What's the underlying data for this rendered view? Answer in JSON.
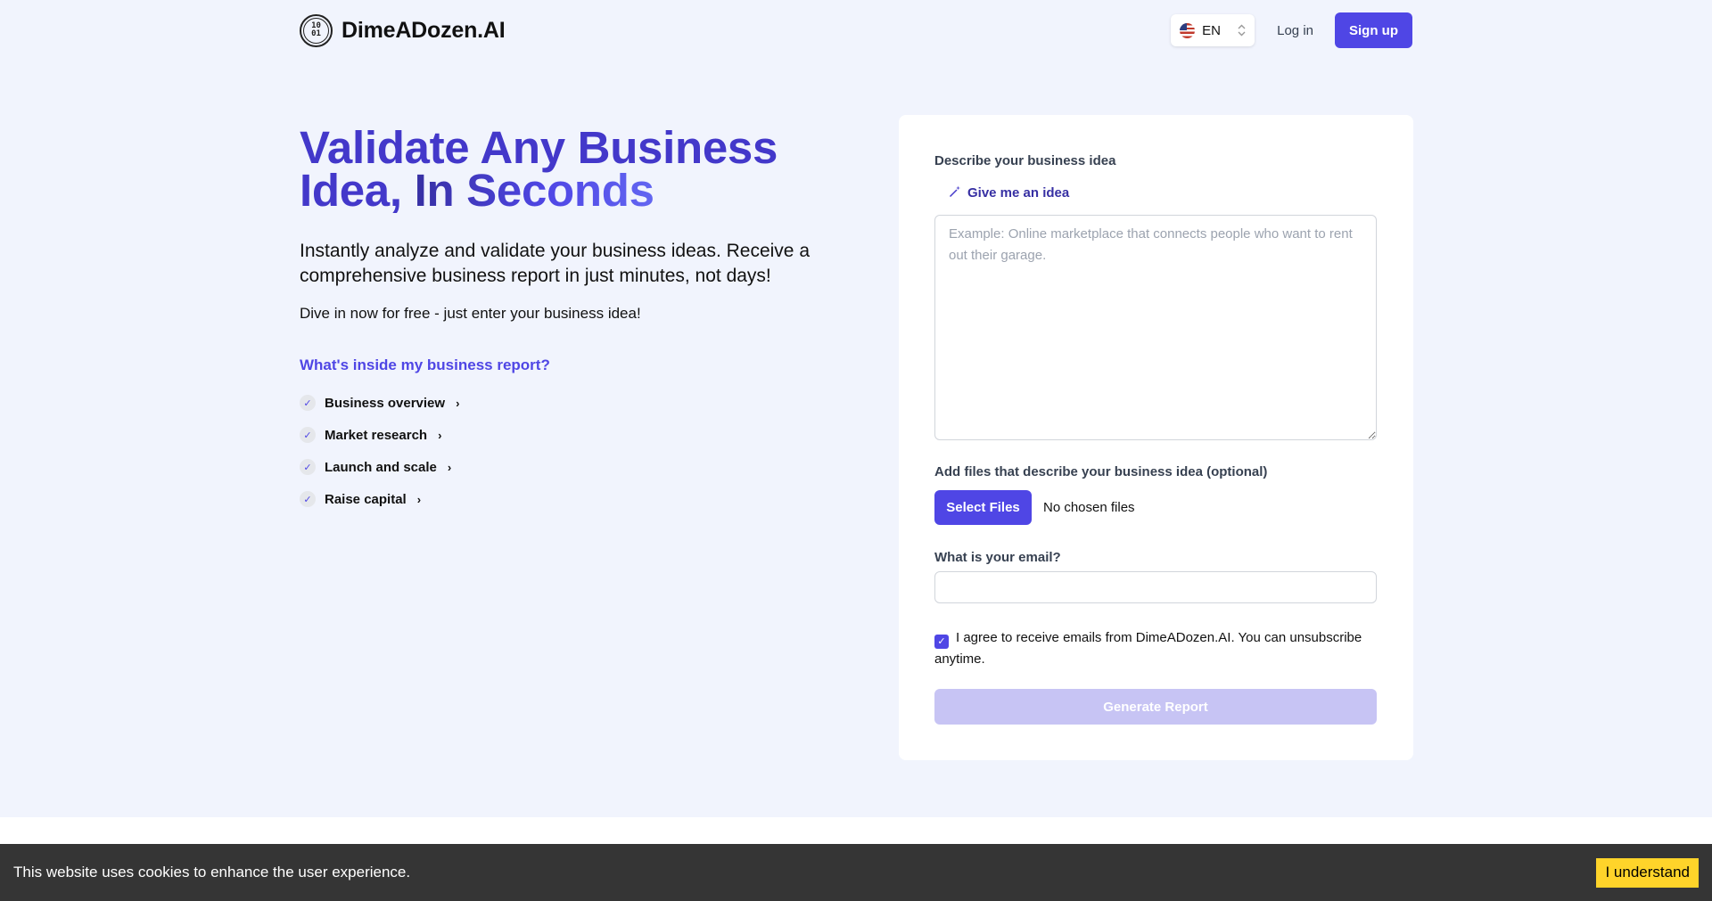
{
  "header": {
    "brand": "DimeADozen.AI",
    "logo_icon_digits": "10\n01",
    "language": "EN",
    "login_label": "Log in",
    "signup_label": "Sign up"
  },
  "hero": {
    "headline_part1": "Validate Any Business Idea, ",
    "headline_part2": "In Seconds",
    "subheading": "Instantly analyze and validate your business ideas. Receive a comprehensive business report in just minutes, not days!",
    "dive_text": "Dive in now for free - just enter your business idea!",
    "report_title": "What's inside my business report?",
    "report_items": [
      {
        "label": "Business overview"
      },
      {
        "label": "Market research"
      },
      {
        "label": "Launch and scale"
      },
      {
        "label": "Raise capital"
      }
    ]
  },
  "form": {
    "idea_label": "Describe your business idea",
    "give_idea_label": "Give me an idea",
    "idea_placeholder": "Example: Online marketplace that connects people who want to rent out their garage.",
    "idea_value": "",
    "files_label": "Add files that describe your business idea (optional)",
    "select_files_label": "Select Files",
    "no_files_text": "No chosen files",
    "email_label": "What is your email?",
    "email_value": "",
    "agree_text": "I agree to receive emails from DimeADozen.AI. You can unsubscribe anytime.",
    "agree_checked": true,
    "generate_label": "Generate Report"
  },
  "cookie": {
    "text": "This website uses cookies to enhance the user experience.",
    "button_label": "I understand"
  },
  "colors": {
    "accent": "#4f46e5",
    "hero_bg": "#f1f4fd",
    "cookie_bar": "#353535",
    "cookie_button": "#ffd42a",
    "generate_disabled": "#c7c4f4"
  }
}
